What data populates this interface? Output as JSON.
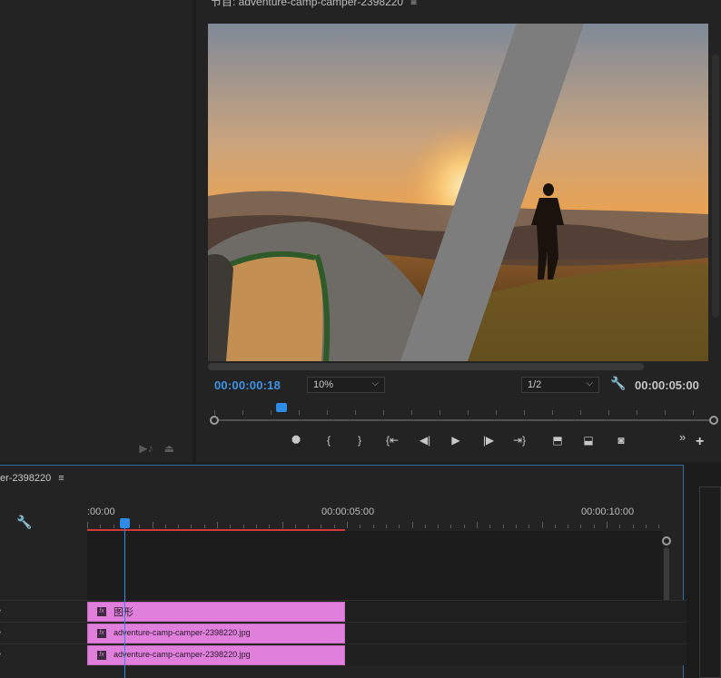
{
  "program_monitor": {
    "title": "节目: adventure-camp-camper-2398220",
    "menu_glyph": "≡",
    "current_timecode": "00:00:00:18",
    "zoom": "10%",
    "resolution": "1/2",
    "duration": "00:00:05:00",
    "transport_buttons": [
      {
        "name": "add-marker-icon",
        "glyph": "⯃"
      },
      {
        "name": "mark-in-icon",
        "glyph": "{"
      },
      {
        "name": "mark-out-icon",
        "glyph": "}"
      },
      {
        "name": "go-to-in-icon",
        "glyph": "{⇤"
      },
      {
        "name": "step-back-icon",
        "glyph": "◀|"
      },
      {
        "name": "play-icon",
        "glyph": "▶"
      },
      {
        "name": "step-forward-icon",
        "glyph": "|▶"
      },
      {
        "name": "go-to-out-icon",
        "glyph": "⇥}"
      },
      {
        "name": "lift-icon",
        "glyph": "⬒"
      },
      {
        "name": "extract-icon",
        "glyph": "⬓"
      },
      {
        "name": "export-frame-icon",
        "glyph": "◙"
      }
    ],
    "overflow_glyph": "»",
    "add_glyph": "+"
  },
  "source_panel": {
    "icons": [
      "audio-only-icon",
      "export-icon"
    ]
  },
  "timeline": {
    "sequence_tab": "er-2398220",
    "menu_glyph": "≡",
    "ruler_labels": [
      ":00:00",
      "00:00:05:00",
      "00:00:10:00"
    ],
    "tracks": [
      {
        "clip": "图形"
      },
      {
        "clip": "adventure-camp-camper-2398220.jpg"
      },
      {
        "clip": "adventure-camp-camper-2398220.jpg"
      }
    ]
  },
  "colors": {
    "accent_blue": "#2e8be6",
    "clip_pink": "#e07fdc",
    "work_area_red": "#d03a3a"
  }
}
